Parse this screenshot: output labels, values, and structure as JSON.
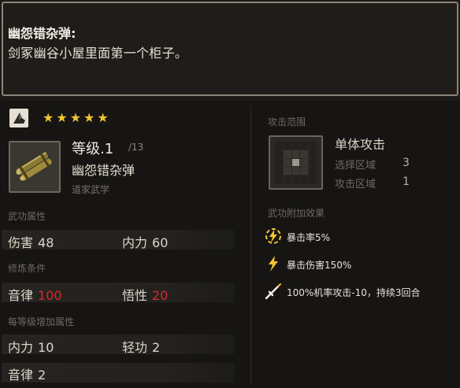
{
  "description": {
    "title": "幽怨错杂弹:",
    "text": "剑冢幽谷小屋里面第一个柜子。"
  },
  "item": {
    "type_icon": "book-page-icon",
    "stars": "★★★★★",
    "star_count": 5,
    "icon": "bamboo-scroll-icon",
    "level_label": "等级.1",
    "level_max": "/13",
    "name": "幽怨错杂弹",
    "school": "道家武学"
  },
  "sections": {
    "wugong_attrs": "武功属性",
    "training_req": "修炼条件",
    "per_level": "每等级增加属性",
    "attack_range": "攻击范围",
    "extra_effects": "武功附加效果"
  },
  "attrs": [
    {
      "label": "伤害",
      "value": "48"
    },
    {
      "label": "内力",
      "value": "60"
    }
  ],
  "requirements": [
    {
      "label": "音律",
      "value": "100"
    },
    {
      "label": "悟性",
      "value": "20"
    }
  ],
  "per_level_stats": [
    {
      "label": "内力",
      "value": "10"
    },
    {
      "label": "轻功",
      "value": "2"
    },
    {
      "label": "音律",
      "value": "2"
    }
  ],
  "range": {
    "attack_type": "单体攻击",
    "select_label": "选择区域",
    "select_value": "3",
    "attack_label": "攻击区域",
    "attack_value": "1"
  },
  "effects": [
    {
      "icon": "lightning-burst-icon",
      "text": "暴击率5%"
    },
    {
      "icon": "lightning-bolt-icon",
      "text": "暴击伤害150%"
    },
    {
      "icon": "sword-icon",
      "text": "100%机率攻击-10，持续3回合"
    }
  ],
  "colors": {
    "star": "#f2c531",
    "unmet_requirement": "#d8272b",
    "effect_icon": "#f2c531"
  }
}
